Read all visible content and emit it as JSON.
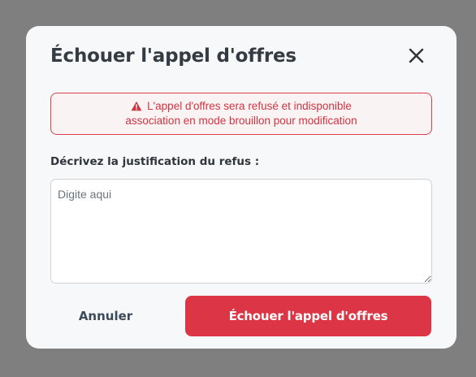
{
  "modal": {
    "title": "Échouer l'appel d'offres",
    "close_icon": "close-icon",
    "alert": {
      "icon": "warning-triangle-icon",
      "line1": "L'appel d'offres sera refusé et indisponible",
      "line2": "association en mode brouillon pour modification",
      "color": "#dc3545"
    },
    "field_label": "Décrivez la justification du refus :",
    "textarea": {
      "placeholder": "Digite aqui",
      "value": ""
    },
    "cancel_label": "Annuler",
    "confirm_label": "Échouer l'appel d'offres",
    "confirm_color": "#dc3545"
  }
}
